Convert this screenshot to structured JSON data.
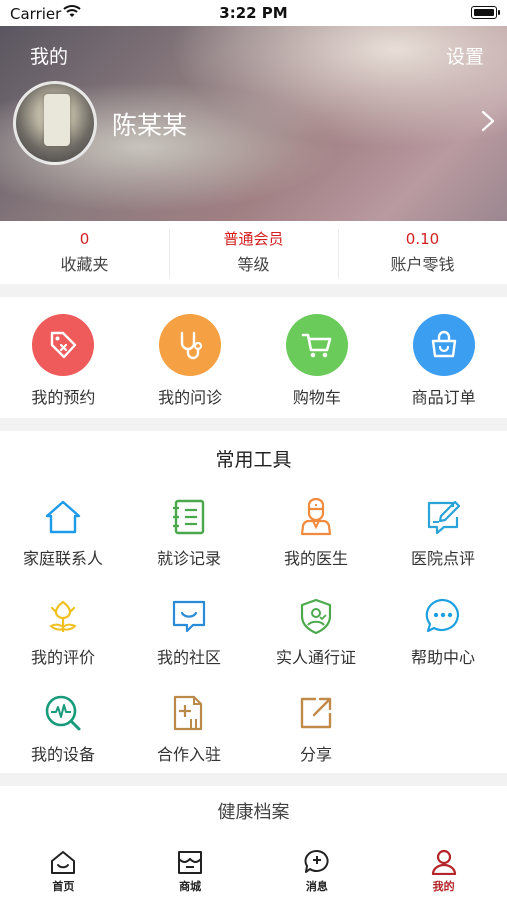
{
  "status_bar": {
    "carrier": "Carrier",
    "time": "3:22 PM"
  },
  "header": {
    "title": "我的",
    "settings": "设置",
    "user_name": "陈某某"
  },
  "stats": [
    {
      "value": "0",
      "label": "收藏夹"
    },
    {
      "value": "普通会员",
      "label": "等级"
    },
    {
      "value": "0.10",
      "label": "账户零钱"
    }
  ],
  "orders": [
    {
      "label": "我的预约",
      "icon": "tag-icon",
      "color": "#ef5a5a"
    },
    {
      "label": "我的问诊",
      "icon": "stethoscope-icon",
      "color": "#f5a042"
    },
    {
      "label": "购物车",
      "icon": "cart-icon",
      "color": "#6acb5a"
    },
    {
      "label": "商品订单",
      "icon": "bag-icon",
      "color": "#3c9ef0"
    }
  ],
  "tools": {
    "title": "常用工具",
    "items": [
      {
        "label": "家庭联系人",
        "icon": "home-icon",
        "color": "#1e9be8"
      },
      {
        "label": "就诊记录",
        "icon": "record-icon",
        "color": "#49a84a"
      },
      {
        "label": "我的医生",
        "icon": "doctor-icon",
        "color": "#f08a3c"
      },
      {
        "label": "医院点评",
        "icon": "edit-icon",
        "color": "#2aa3d8"
      },
      {
        "label": "我的评价",
        "icon": "tulip-icon",
        "color": "#f0c020"
      },
      {
        "label": "我的社区",
        "icon": "chat-smile-icon",
        "color": "#2a8bd8"
      },
      {
        "label": "实人通行证",
        "icon": "shield-user-icon",
        "color": "#4caa4c"
      },
      {
        "label": "帮助中心",
        "icon": "chat-dots-icon",
        "color": "#1ea0e0"
      },
      {
        "label": "我的设备",
        "icon": "pulse-search-icon",
        "color": "#179b7a"
      },
      {
        "label": "合作入驻",
        "icon": "document-plus-icon",
        "color": "#b98a4a"
      },
      {
        "label": "分享",
        "icon": "share-icon",
        "color": "#c08a4a"
      }
    ]
  },
  "health": {
    "title": "健康档案"
  },
  "tabbar": [
    {
      "label": "首页",
      "icon": "home-tab-icon",
      "active": false
    },
    {
      "label": "商城",
      "icon": "store-tab-icon",
      "active": false
    },
    {
      "label": "消息",
      "icon": "message-tab-icon",
      "active": false
    },
    {
      "label": "我的",
      "icon": "person-tab-icon",
      "active": true
    }
  ],
  "colors": {
    "accent": "#b3262a",
    "stat_value": "#d42020"
  }
}
